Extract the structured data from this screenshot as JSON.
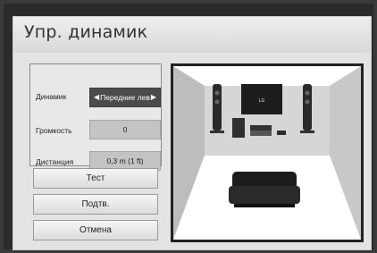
{
  "screen": {
    "title": "Упр. динамик"
  },
  "settings": {
    "speaker": {
      "label": "Динамик",
      "value": "Передние лев"
    },
    "volume": {
      "label": "Громкость",
      "value": "0"
    },
    "distance": {
      "label": "Дистанция",
      "value": "0,3 m (1 ft)"
    }
  },
  "buttons": {
    "test": "Тест",
    "confirm": "Подтв.",
    "cancel": "Отмена"
  },
  "icons": {
    "left_arrow": "◀",
    "right_arrow": "▶",
    "tv_logo": "LG"
  },
  "colors": {
    "selected_field": "#4b4b4b",
    "panel_bg": "#e3e3e3"
  }
}
